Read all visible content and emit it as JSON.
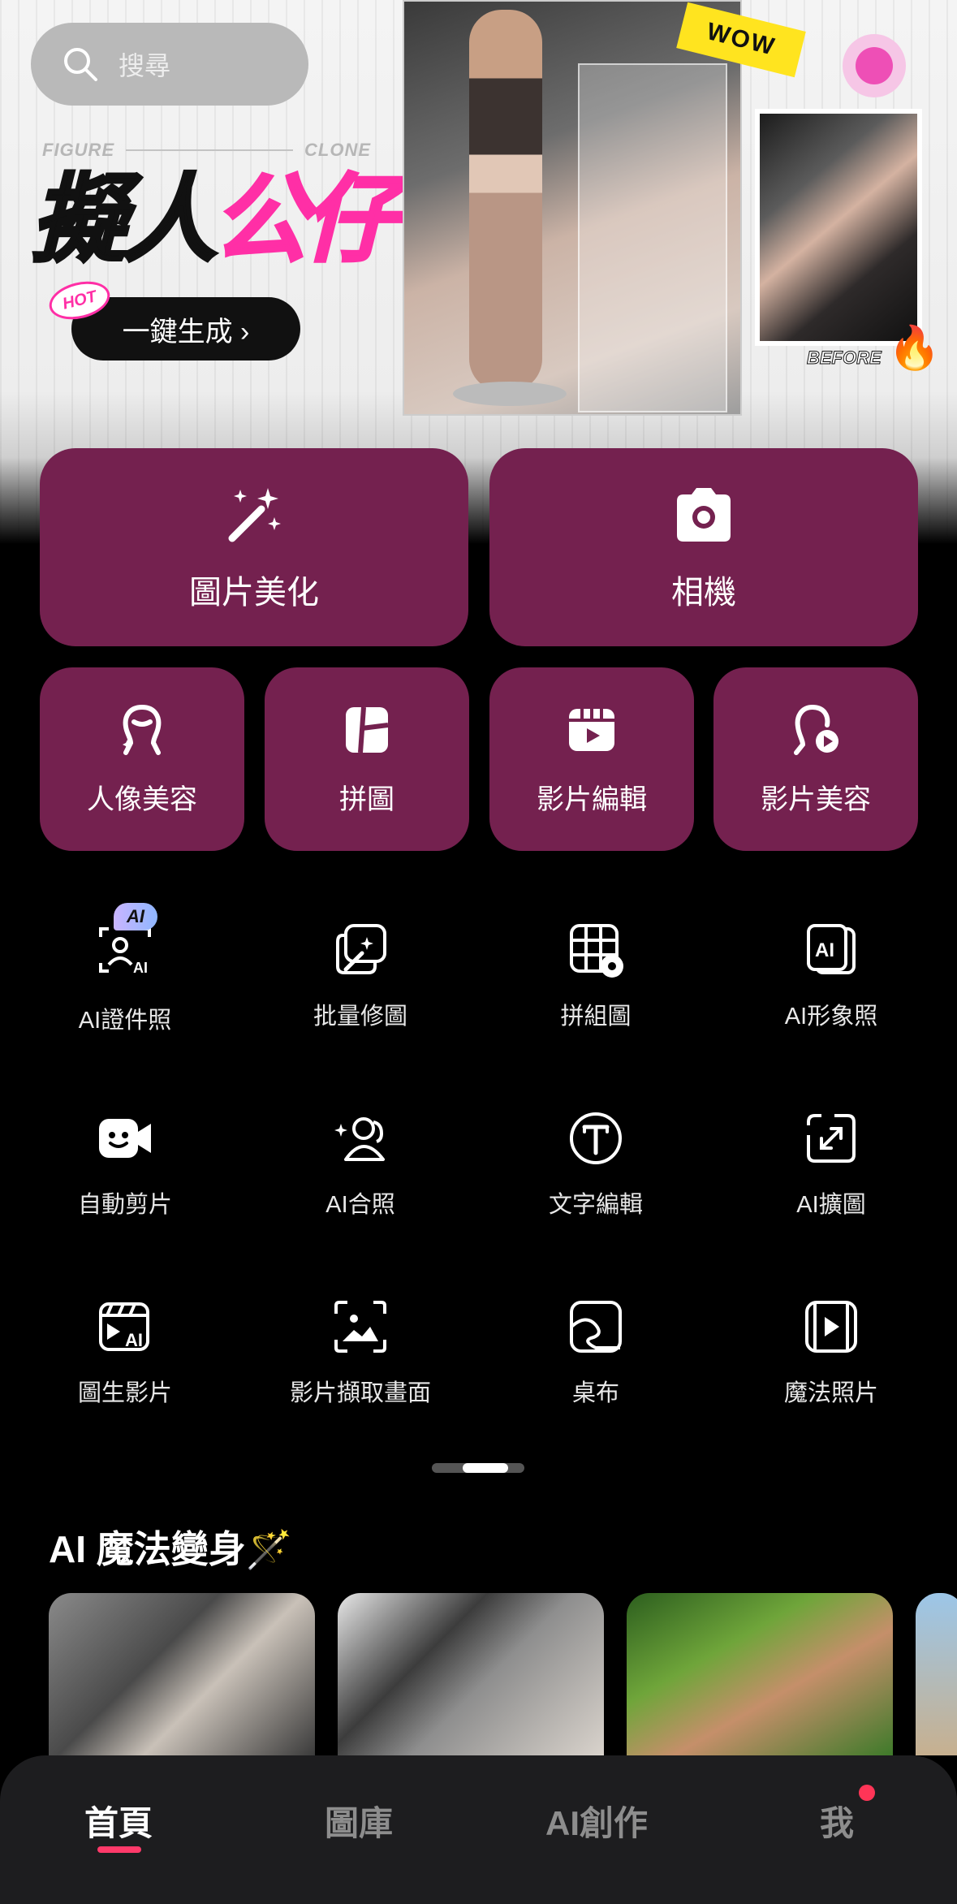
{
  "search": {
    "placeholder": "搜尋"
  },
  "banner": {
    "figure_label": "FIGURE",
    "clone_label": "CLONE",
    "title_part1": "擬人",
    "title_part2": "公仔",
    "hot_badge": "HOT",
    "generate_button": "一鍵生成 ›",
    "wow_tag": "WOW",
    "before_label": "BEFORE"
  },
  "primary_actions": [
    {
      "label": "圖片美化",
      "icon": "magic-wand-icon"
    },
    {
      "label": "相機",
      "icon": "camera-icon"
    }
  ],
  "secondary_actions": [
    {
      "label": "人像美容",
      "icon": "portrait-icon"
    },
    {
      "label": "拼圖",
      "icon": "collage-icon"
    },
    {
      "label": "影片編輯",
      "icon": "video-edit-icon"
    },
    {
      "label": "影片美容",
      "icon": "video-beauty-icon"
    }
  ],
  "tools": [
    {
      "label": "AI證件照",
      "icon": "id-photo-icon",
      "badge": "AI"
    },
    {
      "label": "批量修圖",
      "icon": "batch-edit-icon"
    },
    {
      "label": "拼組圖",
      "icon": "grid-icon"
    },
    {
      "label": "AI形象照",
      "icon": "ai-portrait-icon"
    },
    {
      "label": "自動剪片",
      "icon": "auto-cut-icon"
    },
    {
      "label": "AI合照",
      "icon": "group-photo-icon"
    },
    {
      "label": "文字編輯",
      "icon": "text-icon"
    },
    {
      "label": "AI擴圖",
      "icon": "expand-icon"
    },
    {
      "label": "圖生影片",
      "icon": "image-to-video-icon"
    },
    {
      "label": "影片擷取畫面",
      "icon": "frame-capture-icon"
    },
    {
      "label": "桌布",
      "icon": "wallpaper-icon"
    },
    {
      "label": "魔法照片",
      "icon": "magic-photo-icon"
    }
  ],
  "section": {
    "title": "AI 魔法變身🪄"
  },
  "bottom_nav": [
    {
      "label": "首頁",
      "active": true
    },
    {
      "label": "圖庫",
      "active": false
    },
    {
      "label": "AI創作",
      "active": false
    },
    {
      "label": "我",
      "active": false
    }
  ],
  "colors": {
    "button_bg": "#74214f",
    "accent_pink": "#ff2fa6",
    "nav_indicator": "#ff3a6a"
  }
}
